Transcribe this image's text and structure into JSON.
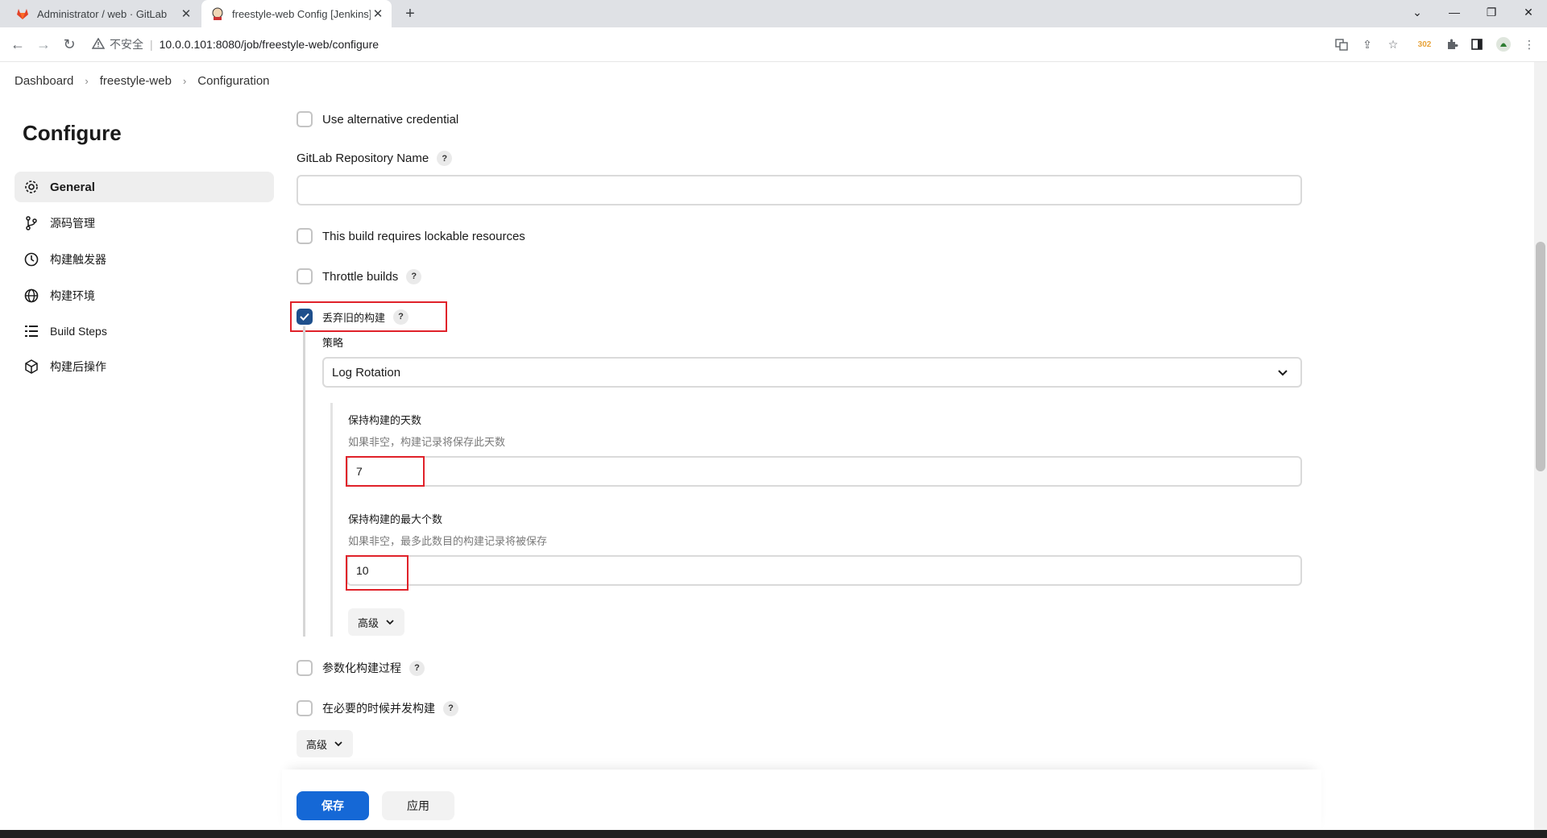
{
  "browser": {
    "tabs": [
      {
        "title": "Administrator / web · GitLab",
        "icon": "gitlab-icon"
      },
      {
        "title": "freestyle-web Config [Jenkins]",
        "icon": "jenkins-icon"
      }
    ],
    "address": {
      "security_text": "不安全",
      "url": "10.0.0.101:8080/job/freestyle-web/configure"
    },
    "extension_badge": "302"
  },
  "breadcrumb": [
    "Dashboard",
    "freestyle-web",
    "Configuration"
  ],
  "sidebar": {
    "title": "Configure",
    "items": [
      {
        "label": "General",
        "icon": "gear-icon",
        "active": true
      },
      {
        "label": "源码管理",
        "icon": "branch-icon"
      },
      {
        "label": "构建触发器",
        "icon": "timer-icon"
      },
      {
        "label": "构建环境",
        "icon": "globe-icon"
      },
      {
        "label": "Build Steps",
        "icon": "list-icon"
      },
      {
        "label": "构建后操作",
        "icon": "cube-icon"
      }
    ]
  },
  "form": {
    "use_alt_credential": {
      "label": "Use alternative credential",
      "checked": false
    },
    "gitlab_repo": {
      "label": "GitLab Repository Name",
      "value": ""
    },
    "lockable": {
      "label": "This build requires lockable resources",
      "checked": false
    },
    "throttle": {
      "label": "Throttle builds",
      "checked": false
    },
    "discard_old": {
      "label": "丢弃旧的构建",
      "checked": true
    },
    "strategy": {
      "label": "策略",
      "value": "Log Rotation"
    },
    "days_to_keep": {
      "label": "保持构建的天数",
      "description": "如果非空，构建记录将保存此天数",
      "value": "7"
    },
    "max_builds": {
      "label": "保持构建的最大个数",
      "description": "如果非空，最多此数目的构建记录将被保存",
      "value": "10"
    },
    "advanced_inner": "高级",
    "parameterized": {
      "label": "参数化构建过程",
      "checked": false
    },
    "concurrent": {
      "label": "在必要的时候并发构建",
      "checked": false
    },
    "advanced_outer": "高级"
  },
  "help_mark": "?",
  "buttons": {
    "save": "保存",
    "apply": "应用"
  }
}
